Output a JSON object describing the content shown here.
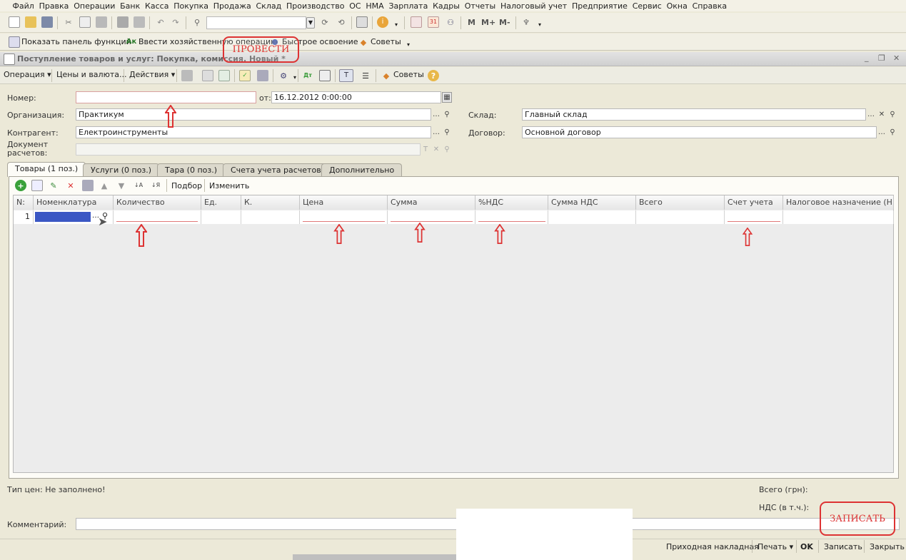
{
  "menu": [
    "Файл",
    "Правка",
    "Операции",
    "Банк",
    "Касса",
    "Покупка",
    "Продажа",
    "Склад",
    "Производство",
    "ОС",
    "НМА",
    "Зарплата",
    "Кадры",
    "Отчеты",
    "Налоговый учет",
    "Предприятие",
    "Сервис",
    "Окна",
    "Справка"
  ],
  "toolbar1": {
    "m": "M",
    "mplus": "M+",
    "mminus": "M-"
  },
  "toolbar2": {
    "show_panel": "Показать панель функций",
    "enter_op": "Ввести хозяйственную операцию",
    "quick": "Быстрое освоение",
    "tips": "Советы"
  },
  "window": {
    "title": "Поступление товаров и услуг: Покупка, комиссия. Новый *",
    "min": "_",
    "restore": "❐",
    "close": "✕"
  },
  "doctoolbar": {
    "operation": "Операция",
    "prices": "Цены и валюта...",
    "actions": "Действия",
    "tips": "Советы",
    "help": "?"
  },
  "form": {
    "number_label": "Номер:",
    "number_value": "",
    "from_label": "от:",
    "date_value": "16.12.2012  0:00:00",
    "org_label": "Организация:",
    "org_value": "Практикум",
    "contractor_label": "Контрагент:",
    "contractor_value": "Електроинструменты",
    "doc_label_1": "Документ",
    "doc_label_2": "расчетов:",
    "doc_value": "",
    "warehouse_label": "Склад:",
    "warehouse_value": "Главный склад",
    "contract_label": "Договор:",
    "contract_value": "Основной договор"
  },
  "tabs": [
    "Товары (1 поз.)",
    "Услуги (0 поз.)",
    "Тара (0 поз.)",
    "Счета учета расчетов",
    "Дополнительно"
  ],
  "gridtoolbar": {
    "select": "Подбор",
    "change": "Изменить"
  },
  "grid": {
    "columns": [
      "N:",
      "Номенклатура",
      "Количество",
      "Ед.",
      "К.",
      "Цена",
      "Сумма",
      "%НДС",
      "Сумма НДС",
      "Всего",
      "Счет учета",
      "Налоговое назначение (Н..."
    ],
    "rows": [
      {
        "n": "1"
      }
    ]
  },
  "footer": {
    "price_type": "Тип цен: Не заполнено!",
    "total_label": "Всего (грн):",
    "vat_label": "НДС (в т.ч.):",
    "comment_label": "Комментарий:"
  },
  "bottom": {
    "invoice": "Приходная накладная",
    "print": "Печать",
    "ok": "OK",
    "save": "Записать",
    "close": "Закрыть"
  },
  "annotations": {
    "post": "ПРОВЕСТИ",
    "save": "ЗАПИСАТЬ"
  },
  "colors": {
    "annotation": "#dd3333",
    "selected_cell": "#3b57c4"
  }
}
